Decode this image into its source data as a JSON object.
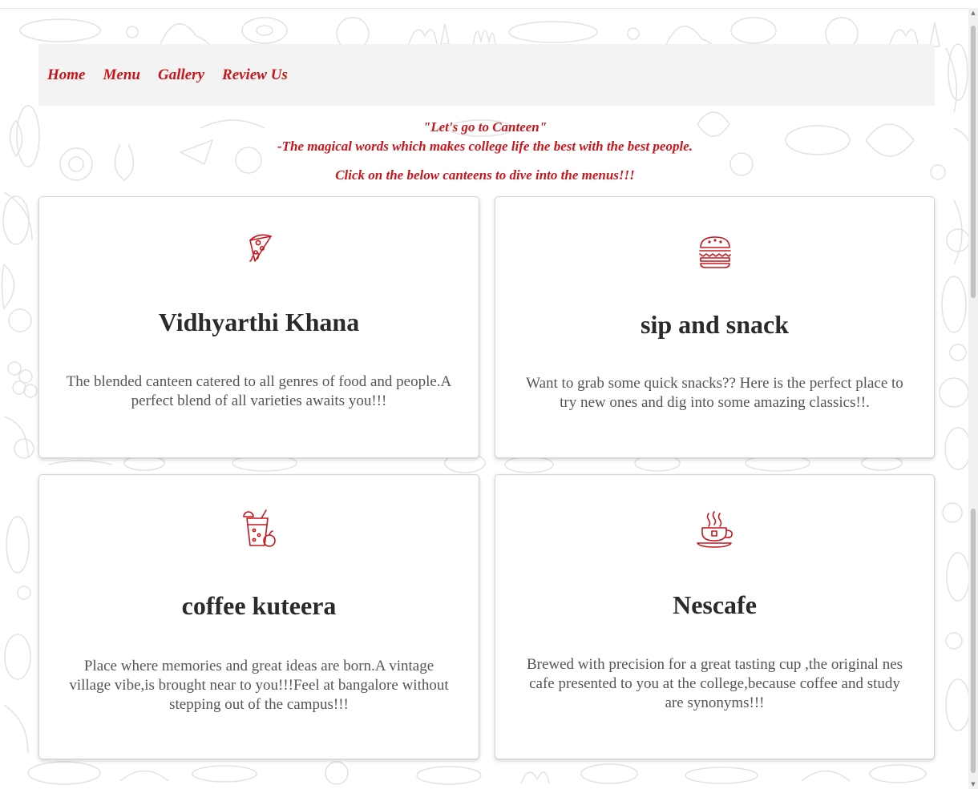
{
  "nav": {
    "items": [
      {
        "label": "Home"
      },
      {
        "label": "Menu"
      },
      {
        "label": "Gallery"
      },
      {
        "label": "Review Us"
      }
    ]
  },
  "intro": {
    "quote": "\"Let's go to Canteen\"",
    "subtitle": "-The magical words which makes college life the best with the best people.",
    "cta": "Click on the below canteens to dive into the menus!!!"
  },
  "canteens": [
    {
      "name": "Vidhyarthi Khana",
      "icon": "pizza-slice-icon",
      "description": "The blended canteen catered to all genres of food and people.A perfect blend of all varieties awaits you!!!"
    },
    {
      "name": "sip and snack",
      "icon": "burger-icon",
      "description": "Want to grab some quick snacks?? Here is the perfect place to try new ones and dig into some amazing classics!!."
    },
    {
      "name": "coffee kuteera",
      "icon": "juice-drink-icon",
      "description": "Place where memories and great ideas are born.A vintage village vibe,is brought near to you!!!Feel at bangalore without stepping out of the campus!!!"
    },
    {
      "name": "Nescafe",
      "icon": "coffee-cup-icon",
      "description": "Brewed with precision for a great tasting cup ,the original nes cafe presented to you at the college,because coffee and study are synonyms!!!"
    }
  ],
  "colors": {
    "accent": "#c8161d",
    "navbar_bg": "#f3f3f3",
    "card_text": "#555555",
    "heading_text": "#2a2a2a"
  }
}
